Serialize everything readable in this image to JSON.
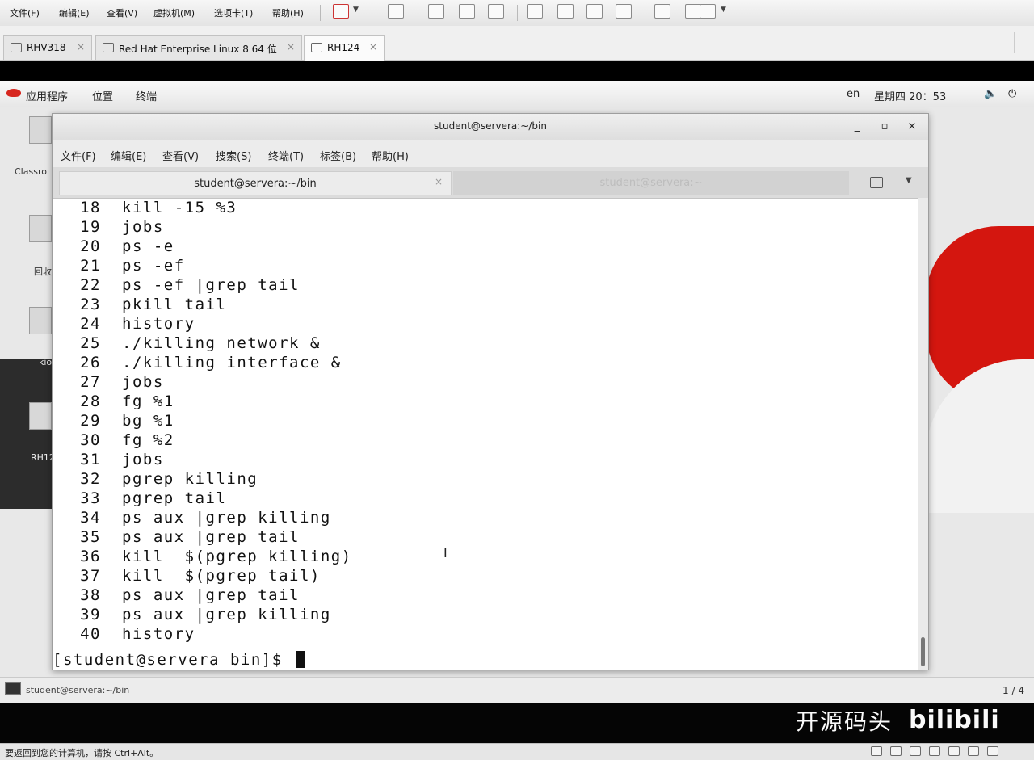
{
  "host": {
    "menu": [
      "文件(F)",
      "编辑(E)",
      "查看(V)",
      "虚拟机(M)",
      "选项卡(T)",
      "帮助(H)"
    ],
    "tabs": [
      {
        "label": "RHV318",
        "close": "×"
      },
      {
        "label": "Red Hat Enterprise Linux 8 64 位",
        "close": "×"
      },
      {
        "label": "RH124",
        "close": "×"
      }
    ],
    "status_text": "要返回到您的计算机，请按 Ctrl+Alt。"
  },
  "guest": {
    "topbar": {
      "menu": [
        "应用程序",
        "位置",
        "终端"
      ],
      "lang": "en",
      "clock": "星期四 20：53",
      "volume_glyph": "🔈",
      "power_glyph": "⏻"
    },
    "desktop_labels": [
      "Classro",
      "回收",
      "kio",
      "RH12"
    ],
    "taskbar": {
      "item_label": "student@servera:~/bin",
      "pager": "1 / 4"
    }
  },
  "terminal": {
    "title": "student@servera:~/bin",
    "wm": {
      "minimize": "_",
      "maximize": "▫",
      "close": "×"
    },
    "menu": [
      "文件(F)",
      "编辑(E)",
      "查看(V)",
      "搜索(S)",
      "终端(T)",
      "标签(B)",
      "帮助(H)"
    ],
    "tabs": [
      {
        "label": "student@servera:~/bin",
        "close": "×"
      },
      {
        "label": "student@servera:~"
      }
    ],
    "tab_menu_glyph": "▼",
    "history": [
      {
        "num": "18",
        "cmd": "kill -15 %3"
      },
      {
        "num": "19",
        "cmd": "jobs"
      },
      {
        "num": "20",
        "cmd": "ps -e"
      },
      {
        "num": "21",
        "cmd": "ps -ef"
      },
      {
        "num": "22",
        "cmd": "ps -ef |grep tail"
      },
      {
        "num": "23",
        "cmd": "pkill tail"
      },
      {
        "num": "24",
        "cmd": "history"
      },
      {
        "num": "25",
        "cmd": "./killing network &"
      },
      {
        "num": "26",
        "cmd": "./killing interface &"
      },
      {
        "num": "27",
        "cmd": "jobs"
      },
      {
        "num": "28",
        "cmd": "fg %1"
      },
      {
        "num": "29",
        "cmd": "bg %1"
      },
      {
        "num": "30",
        "cmd": "fg %2"
      },
      {
        "num": "31",
        "cmd": "jobs"
      },
      {
        "num": "32",
        "cmd": "pgrep killing"
      },
      {
        "num": "33",
        "cmd": "pgrep tail"
      },
      {
        "num": "34",
        "cmd": "ps aux |grep killing"
      },
      {
        "num": "35",
        "cmd": "ps aux |grep tail"
      },
      {
        "num": "36",
        "cmd": "kill  $(pgrep killing)"
      },
      {
        "num": "37",
        "cmd": "kill  $(pgrep tail)"
      },
      {
        "num": "38",
        "cmd": "ps aux |grep tail"
      },
      {
        "num": "39",
        "cmd": "ps aux |grep killing"
      },
      {
        "num": "40",
        "cmd": "history"
      }
    ],
    "prompt": "[student@servera bin]$ "
  },
  "watermark": {
    "text": "开源码头",
    "logo": "bilibili"
  }
}
